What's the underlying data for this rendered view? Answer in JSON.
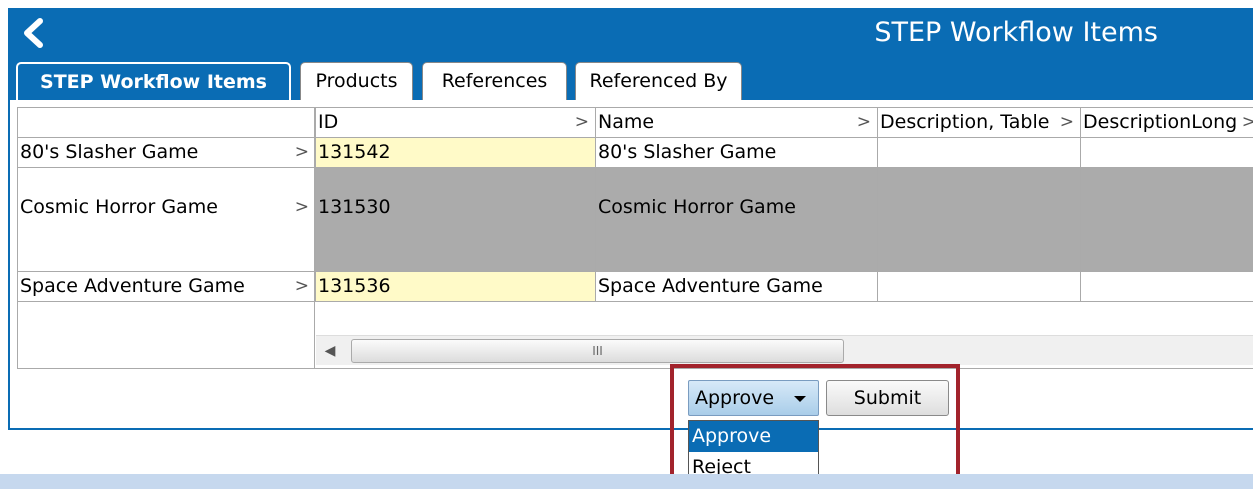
{
  "header": {
    "title": "STEP Workflow Items",
    "back_icon": "chevron-left-icon"
  },
  "tabs": [
    {
      "label": "STEP Workflow Items",
      "active": true
    },
    {
      "label": "Products",
      "active": false
    },
    {
      "label": "References",
      "active": false
    },
    {
      "label": "Referenced By",
      "active": false
    }
  ],
  "grid": {
    "columns": [
      "ID",
      "Name",
      "Description, Table",
      "DescriptionLong"
    ],
    "rows": [
      {
        "label": "80's Slasher Game",
        "id": "131542",
        "name": "80's Slasher Game",
        "description_table": "",
        "description_long": ""
      },
      {
        "label": "Cosmic Horror Game",
        "id": "131530",
        "name": "Cosmic Horror Game",
        "description_table": "",
        "description_long": ""
      },
      {
        "label": "Space Adventure Game",
        "id": "131536",
        "name": "Space Adventure Game",
        "description_table": "",
        "description_long": ""
      }
    ],
    "chevron": ">",
    "scroll_thumb_grip": "III",
    "scroll_left_glyph": "◀"
  },
  "actions": {
    "select_value": "Approve",
    "submit_label": "Submit",
    "options": [
      "Approve",
      "Reject"
    ],
    "selected_option": "Approve"
  },
  "colors": {
    "header_blue": "#0a6cb4",
    "id_highlight": "#fffac8",
    "selected_row": "#ababab",
    "callout_border": "#a2232c"
  }
}
